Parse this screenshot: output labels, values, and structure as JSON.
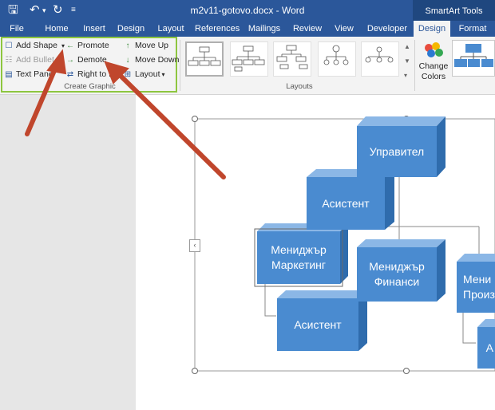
{
  "window": {
    "title": "m2v11-gotovo.docx - Word",
    "context_label": "SmartArt Tools"
  },
  "tabs": [
    "File",
    "Home",
    "Insert",
    "Design",
    "Layout",
    "References",
    "Mailings",
    "Review",
    "View",
    "Developer",
    "Design",
    "Format"
  ],
  "active_tab": "Design",
  "create_graphic": {
    "add_shape": "Add Shape",
    "add_bullet": "Add Bullet",
    "text_pane": "Text Pane",
    "promote": "Promote",
    "demote": "Demote",
    "right_to_left": "Right to Left",
    "move_up": "Move Up",
    "move_down": "Move Down",
    "layout": "Layout",
    "group_label": "Create Graphic"
  },
  "layouts": {
    "group_label": "Layouts"
  },
  "smartart_styles": {
    "change_colors_line1": "Change",
    "change_colors_line2": "Colors"
  },
  "org_chart": {
    "manager": "Управител",
    "assistant_top": "Асистент",
    "marketing_line1": "Мениджър",
    "marketing_line2": "Маркетинг",
    "finance_line1": "Мениджър",
    "finance_line2": "Финанси",
    "production_line1": "Мени",
    "production_line2": "Произв",
    "assistant_bottom": "Асистент",
    "partial_bottom": "А"
  },
  "colors": {
    "title_bar": "#2b579a",
    "context_tab": "#1f477f",
    "shape_fill": "#4a8bd0",
    "highlight": "#8dc63f",
    "arrow": "#c0462c"
  }
}
